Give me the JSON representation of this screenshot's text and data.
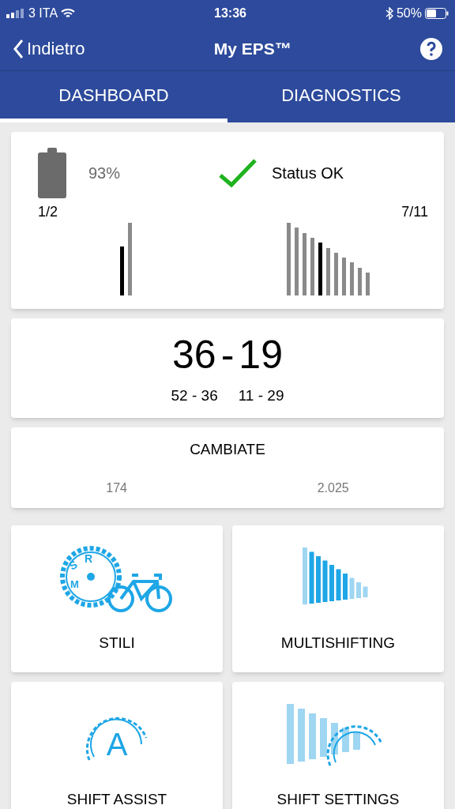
{
  "status_bar": {
    "carrier": "3 ITA",
    "time": "13:36",
    "battery": "50%"
  },
  "header": {
    "back": "Indietro",
    "title": "My EPS™"
  },
  "tabs": [
    {
      "label": "DASHBOARD",
      "selected": true
    },
    {
      "label": "DIAGNOSTICS",
      "selected": false
    }
  ],
  "status_card": {
    "battery": "93%",
    "status": "Status OK",
    "front": {
      "label": "1/2",
      "bars": [
        {
          "selected": true
        },
        {
          "selected": false
        }
      ]
    },
    "rear": {
      "label": "7/11",
      "bars": [
        {
          "selected": false
        },
        {
          "selected": false
        },
        {
          "selected": false
        },
        {
          "selected": false
        },
        {
          "selected": true
        },
        {
          "selected": false
        },
        {
          "selected": false
        },
        {
          "selected": false
        },
        {
          "selected": false
        },
        {
          "selected": false
        },
        {
          "selected": false
        }
      ]
    }
  },
  "gear_card": {
    "ratio": "36",
    "ratio_sep": "-",
    "ratio_rear": "19",
    "chainrings": "52 - 36",
    "cassette": "11 - 29"
  },
  "shifts_card": {
    "title": "CAMBIATE",
    "values": [
      "174",
      "2.025"
    ]
  },
  "tiles": [
    {
      "kind": "styles",
      "label": "STILI",
      "icon_letters": [
        "S",
        "R",
        "M"
      ]
    },
    {
      "kind": "multishift",
      "label": "MULTISHIFTING"
    },
    {
      "kind": "assist",
      "label": "SHIFT ASSIST",
      "icon_letters": [
        "A"
      ]
    },
    {
      "kind": "settings",
      "label": "SHIFT SETTINGS"
    }
  ]
}
